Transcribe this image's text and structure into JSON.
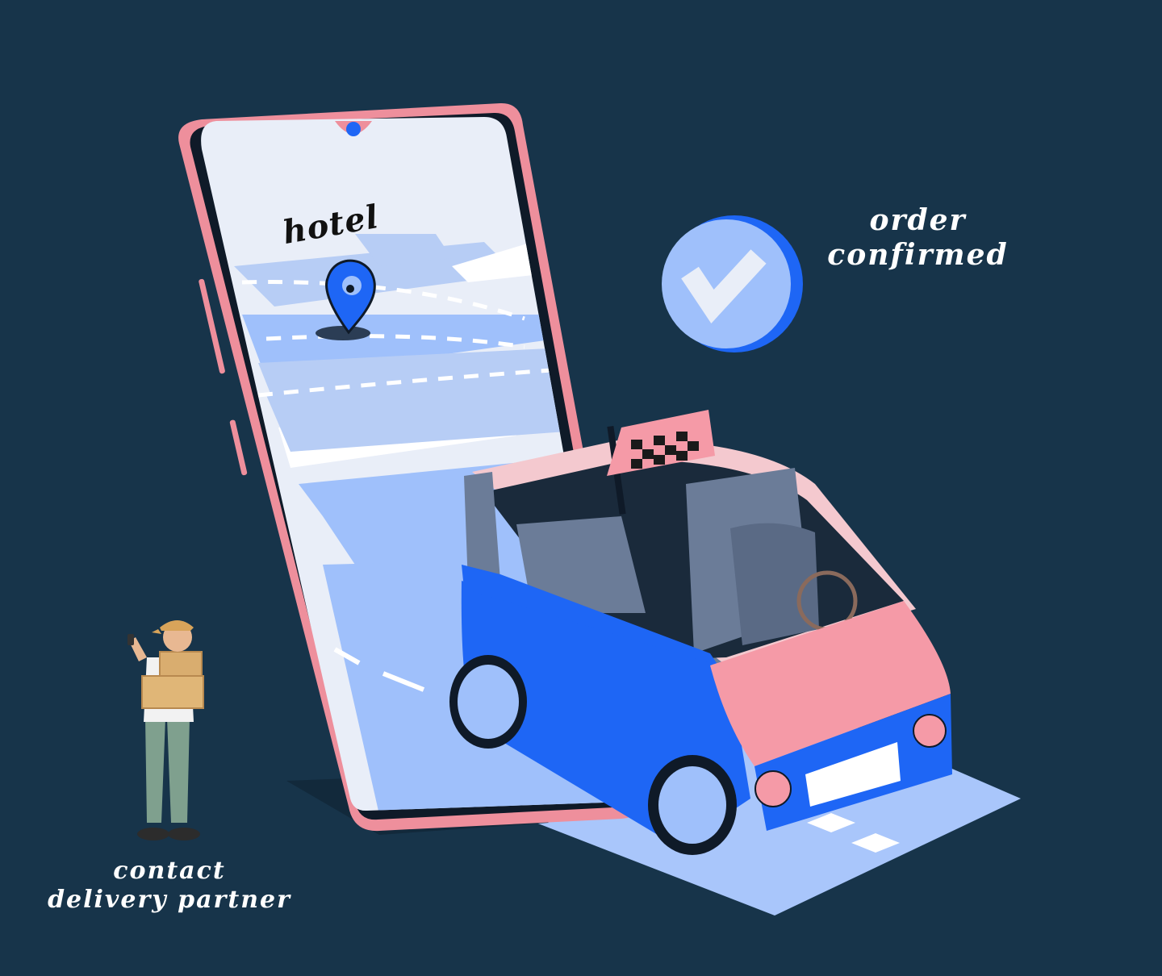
{
  "map": {
    "pin_label": "hotel"
  },
  "status": {
    "line1": "order",
    "line2": "confirmed"
  },
  "person": {
    "line1": "contact",
    "line2": "delivery partner"
  },
  "colors": {
    "background": "#17344a",
    "phone_frame": "#ee8f9c",
    "accent_blue": "#1e66f5",
    "light_blue": "#9fc0fb",
    "screen_bg": "#e9eef8",
    "car_pink": "#f59aa7"
  },
  "icons": [
    "location-pin-icon",
    "check-icon",
    "taxi-sign-icon"
  ]
}
